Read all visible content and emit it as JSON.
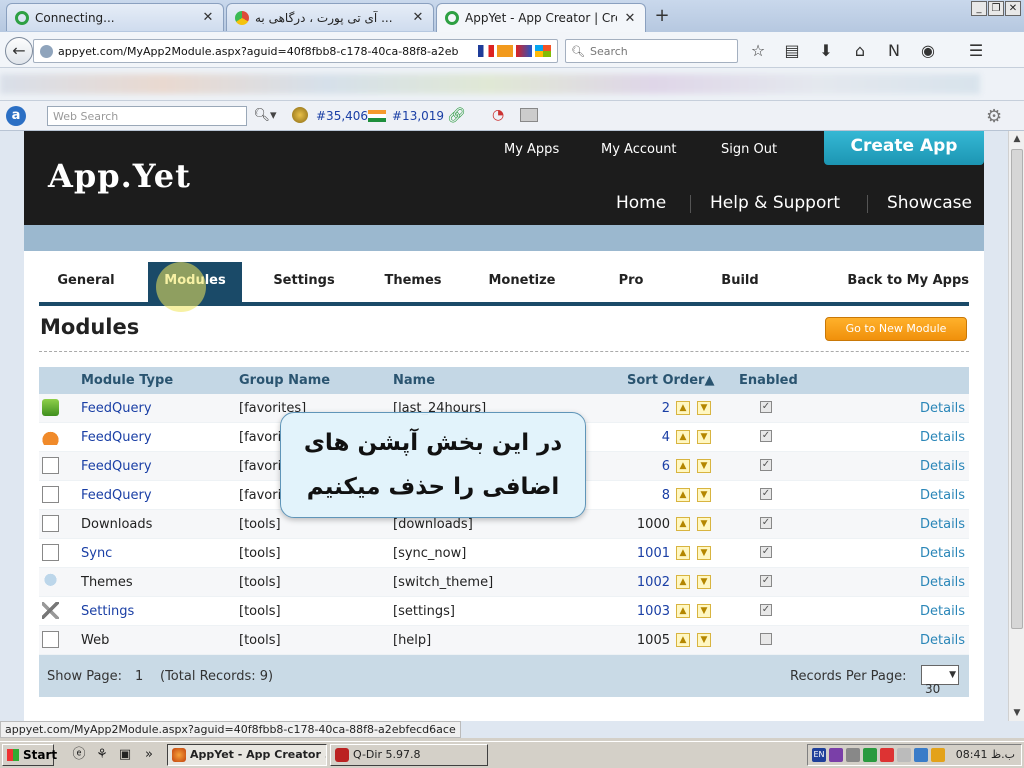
{
  "browser": {
    "tabs": [
      {
        "label": "Connecting...",
        "color": "#2ea043"
      },
      {
        "label": "آی تی پورت ، درگاهی به ...",
        "color": "#dd4b39"
      },
      {
        "label": "AppYet - App Creator | Creat...",
        "color": "#2ea043"
      }
    ],
    "newtab_icon": "+",
    "url": "appyet.com/MyApp2Module.aspx?aguid=40f8fbb8-c178-40ca-88f8-a2eb",
    "search_placeholder": "Search",
    "websearch_placeholder": "Web Search",
    "rank_world": "#35,406",
    "rank_country": "#13,019"
  },
  "site": {
    "logo": "App.Yet",
    "toplinks": [
      "My Apps",
      "My Account",
      "Sign Out"
    ],
    "create_app": "Create App",
    "mainnav": [
      "Home",
      "Help & Support",
      "Showcase"
    ],
    "tabs": [
      "General",
      "Modules",
      "Settings",
      "Themes",
      "Monetize",
      "Pro",
      "Build",
      "Back to My Apps"
    ],
    "active_tab": "Modules",
    "page_title": "Modules",
    "go_button": "Go to New Module",
    "columns": {
      "type": "Module Type",
      "group": "Group Name",
      "name": "Name",
      "order": "Sort Order▲",
      "enabled": "Enabled"
    },
    "rows": [
      {
        "type": "FeedQuery",
        "group": "[favorites]",
        "name": "[last_24hours]",
        "order": "2",
        "enabled": true,
        "details": "Details",
        "icon": "rss-icon"
      },
      {
        "type": "FeedQuery",
        "group": "[favori",
        "name": "",
        "order": "4",
        "enabled": true,
        "details": "Details",
        "icon": "bowl-icon"
      },
      {
        "type": "FeedQuery",
        "group": "[favori",
        "name": "",
        "order": "6",
        "enabled": true,
        "details": "Details",
        "icon": "page-icon"
      },
      {
        "type": "FeedQuery",
        "group": "[favori",
        "name": "",
        "order": "8",
        "enabled": true,
        "details": "Details",
        "icon": "page-icon"
      },
      {
        "type": "Downloads",
        "group": "[tools]",
        "name": "[downloads]",
        "order": "1000",
        "enabled": true,
        "details": "Details",
        "icon": "page-icon"
      },
      {
        "type": "Sync",
        "group": "[tools]",
        "name": "[sync_now]",
        "order": "1001",
        "enabled": true,
        "details": "Details",
        "icon": "page-icon"
      },
      {
        "type": "Themes",
        "group": "[tools]",
        "name": "[switch_theme]",
        "order": "1002",
        "enabled": true,
        "details": "Details",
        "icon": "bulb-icon"
      },
      {
        "type": "Settings",
        "group": "[tools]",
        "name": "[settings]",
        "order": "1003",
        "enabled": true,
        "details": "Details",
        "icon": "tools-icon"
      },
      {
        "type": "Web",
        "group": "[tools]",
        "name": "[help]",
        "order": "1005",
        "enabled": false,
        "details": "Details",
        "icon": "page-icon"
      }
    ],
    "footer": {
      "show_page": "Show Page:",
      "page": "1",
      "total": "(Total Records: 9)",
      "per_page_label": "Records Per Page:",
      "per_page": "30"
    },
    "callout": {
      "line1": "در این بخش آپشن های",
      "line2": "اضافی را حذف میکنیم"
    }
  },
  "status_url": "appyet.com/MyApp2Module.aspx?aguid=40f8fbb8-c178-40ca-88f8-a2ebfecd6ace",
  "taskbar": {
    "start": "Start",
    "items": [
      "AppYet - App Creator ...",
      "Q-Dir 5.97.8"
    ],
    "lang": "EN",
    "clock": "08:41 ب.ظ"
  }
}
